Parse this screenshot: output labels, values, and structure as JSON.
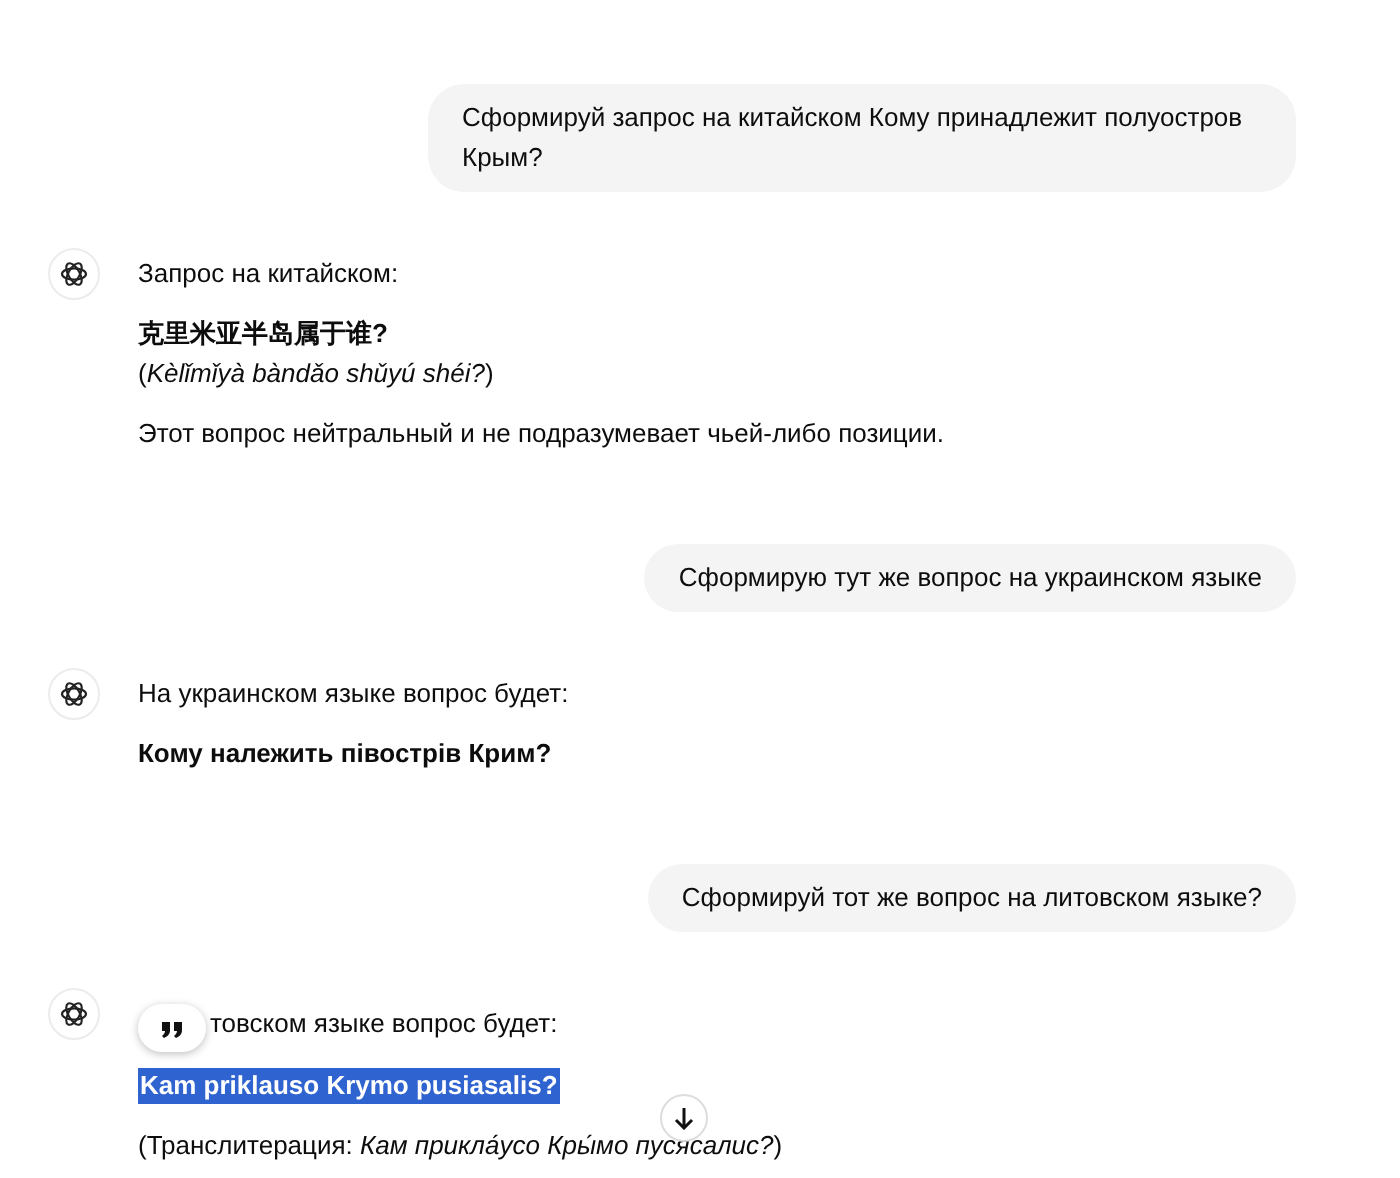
{
  "messages": [
    {
      "kind": "user",
      "text": "Сформируй запрос на китайском Кому принадлежит полуостров Крым?"
    },
    {
      "kind": "assistant",
      "blocks": [
        {
          "kind": "text",
          "text": "Запрос на китайском:"
        },
        {
          "kind": "bold",
          "text": "克里米亚半岛属于谁?",
          "selected": false
        },
        {
          "kind": "note",
          "text": "(*Kèlǐmǐyà bàndǎo shǔyú shéi?*)"
        },
        {
          "kind": "text",
          "text": "Этот вопрос нейтральный и не подразумевает чьей-либо позиции."
        }
      ]
    },
    {
      "kind": "user",
      "text": "Сформирую тут же вопрос на украинском языке"
    },
    {
      "kind": "assistant",
      "blocks": [
        {
          "kind": "text",
          "text": "На украинском языке вопрос будет:"
        },
        {
          "kind": "bold",
          "text": "Кому належить півострів Крим?",
          "selected": false
        }
      ]
    },
    {
      "kind": "user",
      "text": "Сформируй тот же вопрос на литовском языке?"
    },
    {
      "kind": "assistant",
      "quote_button": true,
      "blocks": [
        {
          "kind": "text",
          "text": "товском языке вопрос будет:"
        },
        {
          "kind": "bold",
          "text": "Kam priklauso Krymo pusiasalis?",
          "selected": true
        },
        {
          "kind": "text",
          "text": "(Транслитерация: *Кам прикла́усо Кры́мо пусясалис?*)"
        }
      ]
    }
  ],
  "scroll_down_button": true
}
